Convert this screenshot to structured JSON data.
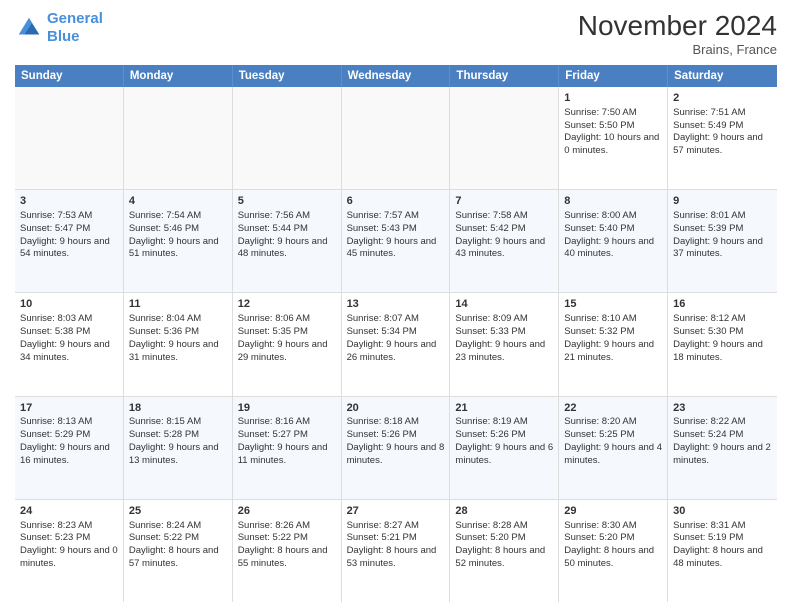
{
  "header": {
    "logo_line1": "General",
    "logo_line2": "Blue",
    "month": "November 2024",
    "location": "Brains, France"
  },
  "days_of_week": [
    "Sunday",
    "Monday",
    "Tuesday",
    "Wednesday",
    "Thursday",
    "Friday",
    "Saturday"
  ],
  "rows": [
    [
      {
        "day": "",
        "info": ""
      },
      {
        "day": "",
        "info": ""
      },
      {
        "day": "",
        "info": ""
      },
      {
        "day": "",
        "info": ""
      },
      {
        "day": "",
        "info": ""
      },
      {
        "day": "1",
        "info": "Sunrise: 7:50 AM\nSunset: 5:50 PM\nDaylight: 10 hours and 0 minutes."
      },
      {
        "day": "2",
        "info": "Sunrise: 7:51 AM\nSunset: 5:49 PM\nDaylight: 9 hours and 57 minutes."
      }
    ],
    [
      {
        "day": "3",
        "info": "Sunrise: 7:53 AM\nSunset: 5:47 PM\nDaylight: 9 hours and 54 minutes."
      },
      {
        "day": "4",
        "info": "Sunrise: 7:54 AM\nSunset: 5:46 PM\nDaylight: 9 hours and 51 minutes."
      },
      {
        "day": "5",
        "info": "Sunrise: 7:56 AM\nSunset: 5:44 PM\nDaylight: 9 hours and 48 minutes."
      },
      {
        "day": "6",
        "info": "Sunrise: 7:57 AM\nSunset: 5:43 PM\nDaylight: 9 hours and 45 minutes."
      },
      {
        "day": "7",
        "info": "Sunrise: 7:58 AM\nSunset: 5:42 PM\nDaylight: 9 hours and 43 minutes."
      },
      {
        "day": "8",
        "info": "Sunrise: 8:00 AM\nSunset: 5:40 PM\nDaylight: 9 hours and 40 minutes."
      },
      {
        "day": "9",
        "info": "Sunrise: 8:01 AM\nSunset: 5:39 PM\nDaylight: 9 hours and 37 minutes."
      }
    ],
    [
      {
        "day": "10",
        "info": "Sunrise: 8:03 AM\nSunset: 5:38 PM\nDaylight: 9 hours and 34 minutes."
      },
      {
        "day": "11",
        "info": "Sunrise: 8:04 AM\nSunset: 5:36 PM\nDaylight: 9 hours and 31 minutes."
      },
      {
        "day": "12",
        "info": "Sunrise: 8:06 AM\nSunset: 5:35 PM\nDaylight: 9 hours and 29 minutes."
      },
      {
        "day": "13",
        "info": "Sunrise: 8:07 AM\nSunset: 5:34 PM\nDaylight: 9 hours and 26 minutes."
      },
      {
        "day": "14",
        "info": "Sunrise: 8:09 AM\nSunset: 5:33 PM\nDaylight: 9 hours and 23 minutes."
      },
      {
        "day": "15",
        "info": "Sunrise: 8:10 AM\nSunset: 5:32 PM\nDaylight: 9 hours and 21 minutes."
      },
      {
        "day": "16",
        "info": "Sunrise: 8:12 AM\nSunset: 5:30 PM\nDaylight: 9 hours and 18 minutes."
      }
    ],
    [
      {
        "day": "17",
        "info": "Sunrise: 8:13 AM\nSunset: 5:29 PM\nDaylight: 9 hours and 16 minutes."
      },
      {
        "day": "18",
        "info": "Sunrise: 8:15 AM\nSunset: 5:28 PM\nDaylight: 9 hours and 13 minutes."
      },
      {
        "day": "19",
        "info": "Sunrise: 8:16 AM\nSunset: 5:27 PM\nDaylight: 9 hours and 11 minutes."
      },
      {
        "day": "20",
        "info": "Sunrise: 8:18 AM\nSunset: 5:26 PM\nDaylight: 9 hours and 8 minutes."
      },
      {
        "day": "21",
        "info": "Sunrise: 8:19 AM\nSunset: 5:26 PM\nDaylight: 9 hours and 6 minutes."
      },
      {
        "day": "22",
        "info": "Sunrise: 8:20 AM\nSunset: 5:25 PM\nDaylight: 9 hours and 4 minutes."
      },
      {
        "day": "23",
        "info": "Sunrise: 8:22 AM\nSunset: 5:24 PM\nDaylight: 9 hours and 2 minutes."
      }
    ],
    [
      {
        "day": "24",
        "info": "Sunrise: 8:23 AM\nSunset: 5:23 PM\nDaylight: 9 hours and 0 minutes."
      },
      {
        "day": "25",
        "info": "Sunrise: 8:24 AM\nSunset: 5:22 PM\nDaylight: 8 hours and 57 minutes."
      },
      {
        "day": "26",
        "info": "Sunrise: 8:26 AM\nSunset: 5:22 PM\nDaylight: 8 hours and 55 minutes."
      },
      {
        "day": "27",
        "info": "Sunrise: 8:27 AM\nSunset: 5:21 PM\nDaylight: 8 hours and 53 minutes."
      },
      {
        "day": "28",
        "info": "Sunrise: 8:28 AM\nSunset: 5:20 PM\nDaylight: 8 hours and 52 minutes."
      },
      {
        "day": "29",
        "info": "Sunrise: 8:30 AM\nSunset: 5:20 PM\nDaylight: 8 hours and 50 minutes."
      },
      {
        "day": "30",
        "info": "Sunrise: 8:31 AM\nSunset: 5:19 PM\nDaylight: 8 hours and 48 minutes."
      }
    ]
  ]
}
